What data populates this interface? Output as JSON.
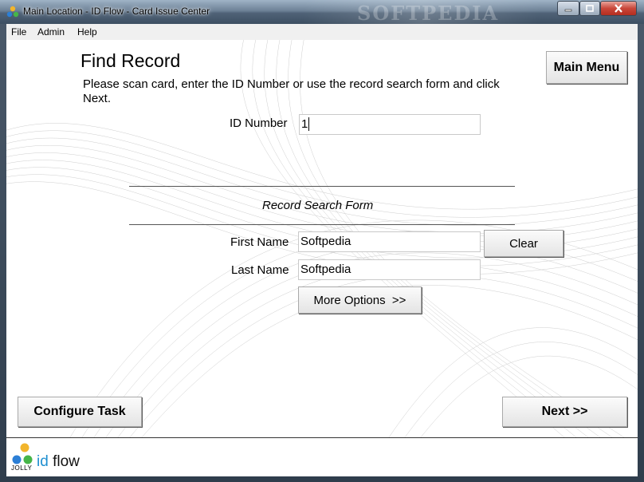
{
  "window": {
    "title": "Main Location - ID Flow - Card Issue Center",
    "watermark": "SOFTPEDIA"
  },
  "menu": [
    "File",
    "Admin",
    "Help"
  ],
  "page": {
    "heading": "Find Record",
    "instructions": "Please scan card, enter the ID Number or use the record search form and click Next.",
    "main_menu_label": "Main Menu",
    "id_number_label": "ID Number",
    "id_number_value": "1",
    "search_form_title": "Record Search Form",
    "first_name_label": "First Name",
    "first_name_value": "Softpedia",
    "last_name_label": "Last Name",
    "last_name_value": "Softpedia",
    "clear_label": "Clear",
    "more_options_label": "More Options  >>",
    "configure_task_label": "Configure Task",
    "next_label": "Next >>"
  },
  "logo": {
    "brand": "JOLLY",
    "id": "id",
    "flow": "flow"
  },
  "icons": {
    "app": "app-dots-icon",
    "minimize": "minimize-icon",
    "maximize": "maximize-icon",
    "close": "close-icon"
  }
}
